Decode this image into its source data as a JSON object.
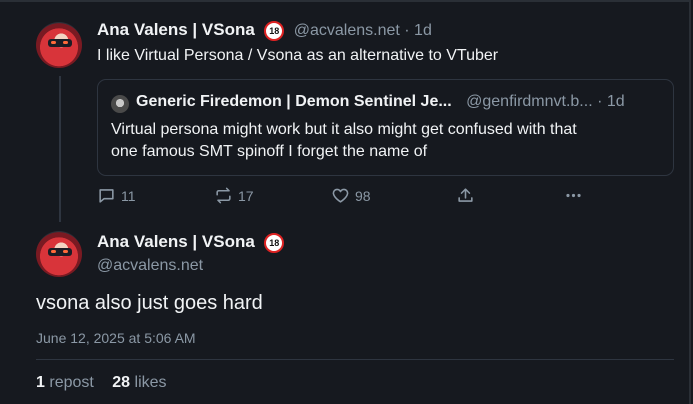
{
  "reply_post": {
    "display_name": "Ana Valens | VSona",
    "badge": "18",
    "handle": "@acvalens.net",
    "separator": "·",
    "age": "1d",
    "text": "I like Virtual Persona / Vsona as an alternative to VTuber",
    "quote": {
      "display_name": "Generic Firedemon | Demon Sentinel Je...",
      "handle": "@genfirdmnvt.b...",
      "separator": "·",
      "age": "1d",
      "text_line1": "Virtual persona might work but it also might get confused with that",
      "text_line2": "one famous SMT spinoff I forget the name of"
    },
    "actions": {
      "replies": "11",
      "reposts": "17",
      "likes": "98"
    }
  },
  "main_post": {
    "display_name": "Ana Valens | VSona",
    "badge": "18",
    "handle": "@acvalens.net",
    "text": "vsona also just goes hard",
    "timestamp": "June 12, 2025 at 5:06 AM",
    "repost_count": "1",
    "repost_label": "repost",
    "like_count": "28",
    "like_label": "likes"
  },
  "icons": [
    "reply-icon",
    "repost-icon",
    "like-icon",
    "share-icon",
    "more-icon"
  ]
}
